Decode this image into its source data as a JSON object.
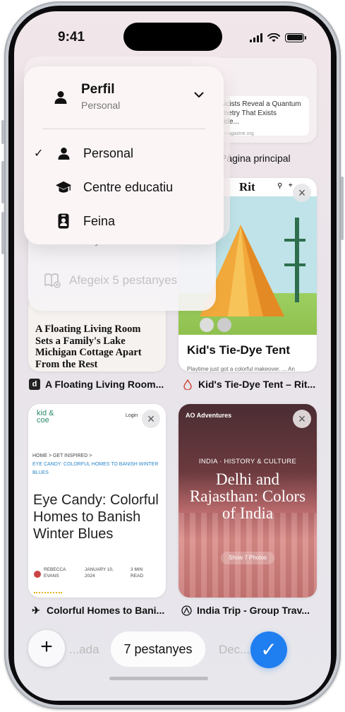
{
  "status_bar": {
    "time": "9:41"
  },
  "profile_menu": {
    "title": "Perfil",
    "subtitle": "Personal",
    "options": [
      {
        "label": "Personal",
        "selected": true,
        "icon": "person-icon"
      },
      {
        "label": "Centre educatiu",
        "selected": false,
        "icon": "graduation-cap-icon"
      },
      {
        "label": "Feina",
        "selected": false,
        "icon": "badge-icon"
      }
    ],
    "check_glyph": "✓"
  },
  "behind_menu": {
    "partial_item": "...y",
    "add_tabs_label": "Afegeix 5 pestanyes"
  },
  "tabs": [
    {
      "caption": "Pàgina principal",
      "preview_headline": "Physicists Reveal a Quantum Geometry That Exists Outside...",
      "preview_source": "quantamagazine.org"
    },
    {
      "caption": "Kid's Tie-Dye Tent – Rit...",
      "preview_logo": "Rit",
      "preview_title": "Kid's Tie-Dye Tent",
      "preview_sub": "Playtime just got a colorful makeover. ... An"
    },
    {
      "caption": "A Floating Living Room...",
      "favicon_letter": "d",
      "preview_title": "A Floating Living Room Sets a Family's Lake Michigan Cottage Apart From the Rest"
    },
    {
      "caption": "Kid's Tie-Dye Tent – Rit...",
      "preview_title": "Kid's Tie-Dye Tent"
    },
    {
      "caption": "Colorful Homes to Bani...",
      "preview_logo": "kid & coe",
      "preview_login": "Login",
      "preview_crumb_home": "HOME  >  GET INSPIRED  >",
      "preview_crumb_link": "EYE CANDY: COLORFUL HOMES TO BANISH WINTER BLUES",
      "preview_title": "Eye Candy: Colorful Homes to Banish Winter Blues",
      "preview_author": "REBECCA EVANS",
      "preview_date": "JANUARY 10, 2024",
      "preview_read": "3 MIN READ"
    },
    {
      "caption": "India Trip - Group Trav...",
      "preview_brand": "AO Adventures",
      "preview_tags": "INDIA  ·  HISTORY & CULTURE",
      "preview_title": "Delhi and Rajasthan: Colors of India",
      "preview_button": "Show 7 Photos"
    }
  ],
  "bottom_bar": {
    "new_tab_glyph": "+",
    "left_segment": "...ada",
    "tab_count_label": "7 pestanyes",
    "right_segment": "Dec...",
    "done_glyph": "✓"
  },
  "colors": {
    "accent": "#1f7ef0",
    "popup_bg": "#fcf5f6",
    "screen_bg": "#ece6ea"
  }
}
